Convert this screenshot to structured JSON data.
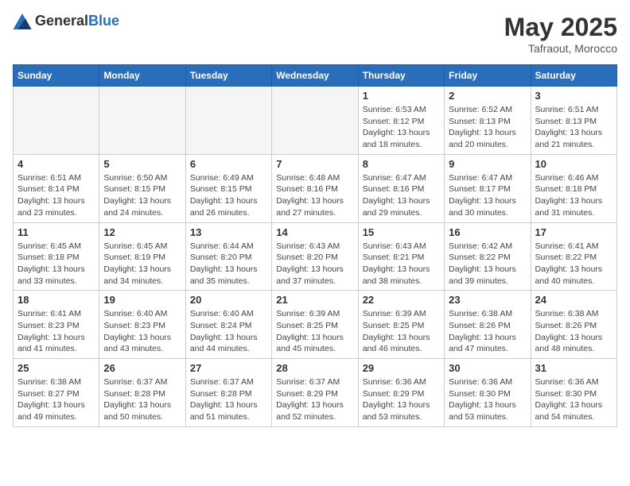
{
  "header": {
    "logo_general": "General",
    "logo_blue": "Blue",
    "month": "May 2025",
    "location": "Tafraout, Morocco"
  },
  "days_of_week": [
    "Sunday",
    "Monday",
    "Tuesday",
    "Wednesday",
    "Thursday",
    "Friday",
    "Saturday"
  ],
  "weeks": [
    [
      {
        "day": "",
        "empty": true
      },
      {
        "day": "",
        "empty": true
      },
      {
        "day": "",
        "empty": true
      },
      {
        "day": "",
        "empty": true
      },
      {
        "day": "1",
        "sunrise": "6:53 AM",
        "sunset": "8:12 PM",
        "daylight": "13 hours and 18 minutes."
      },
      {
        "day": "2",
        "sunrise": "6:52 AM",
        "sunset": "8:13 PM",
        "daylight": "13 hours and 20 minutes."
      },
      {
        "day": "3",
        "sunrise": "6:51 AM",
        "sunset": "8:13 PM",
        "daylight": "13 hours and 21 minutes."
      }
    ],
    [
      {
        "day": "4",
        "sunrise": "6:51 AM",
        "sunset": "8:14 PM",
        "daylight": "13 hours and 23 minutes."
      },
      {
        "day": "5",
        "sunrise": "6:50 AM",
        "sunset": "8:15 PM",
        "daylight": "13 hours and 24 minutes."
      },
      {
        "day": "6",
        "sunrise": "6:49 AM",
        "sunset": "8:15 PM",
        "daylight": "13 hours and 26 minutes."
      },
      {
        "day": "7",
        "sunrise": "6:48 AM",
        "sunset": "8:16 PM",
        "daylight": "13 hours and 27 minutes."
      },
      {
        "day": "8",
        "sunrise": "6:47 AM",
        "sunset": "8:16 PM",
        "daylight": "13 hours and 29 minutes."
      },
      {
        "day": "9",
        "sunrise": "6:47 AM",
        "sunset": "8:17 PM",
        "daylight": "13 hours and 30 minutes."
      },
      {
        "day": "10",
        "sunrise": "6:46 AM",
        "sunset": "8:18 PM",
        "daylight": "13 hours and 31 minutes."
      }
    ],
    [
      {
        "day": "11",
        "sunrise": "6:45 AM",
        "sunset": "8:18 PM",
        "daylight": "13 hours and 33 minutes."
      },
      {
        "day": "12",
        "sunrise": "6:45 AM",
        "sunset": "8:19 PM",
        "daylight": "13 hours and 34 minutes."
      },
      {
        "day": "13",
        "sunrise": "6:44 AM",
        "sunset": "8:20 PM",
        "daylight": "13 hours and 35 minutes."
      },
      {
        "day": "14",
        "sunrise": "6:43 AM",
        "sunset": "8:20 PM",
        "daylight": "13 hours and 37 minutes."
      },
      {
        "day": "15",
        "sunrise": "6:43 AM",
        "sunset": "8:21 PM",
        "daylight": "13 hours and 38 minutes."
      },
      {
        "day": "16",
        "sunrise": "6:42 AM",
        "sunset": "8:22 PM",
        "daylight": "13 hours and 39 minutes."
      },
      {
        "day": "17",
        "sunrise": "6:41 AM",
        "sunset": "8:22 PM",
        "daylight": "13 hours and 40 minutes."
      }
    ],
    [
      {
        "day": "18",
        "sunrise": "6:41 AM",
        "sunset": "8:23 PM",
        "daylight": "13 hours and 41 minutes."
      },
      {
        "day": "19",
        "sunrise": "6:40 AM",
        "sunset": "8:23 PM",
        "daylight": "13 hours and 43 minutes."
      },
      {
        "day": "20",
        "sunrise": "6:40 AM",
        "sunset": "8:24 PM",
        "daylight": "13 hours and 44 minutes."
      },
      {
        "day": "21",
        "sunrise": "6:39 AM",
        "sunset": "8:25 PM",
        "daylight": "13 hours and 45 minutes."
      },
      {
        "day": "22",
        "sunrise": "6:39 AM",
        "sunset": "8:25 PM",
        "daylight": "13 hours and 46 minutes."
      },
      {
        "day": "23",
        "sunrise": "6:38 AM",
        "sunset": "8:26 PM",
        "daylight": "13 hours and 47 minutes."
      },
      {
        "day": "24",
        "sunrise": "6:38 AM",
        "sunset": "8:26 PM",
        "daylight": "13 hours and 48 minutes."
      }
    ],
    [
      {
        "day": "25",
        "sunrise": "6:38 AM",
        "sunset": "8:27 PM",
        "daylight": "13 hours and 49 minutes."
      },
      {
        "day": "26",
        "sunrise": "6:37 AM",
        "sunset": "8:28 PM",
        "daylight": "13 hours and 50 minutes."
      },
      {
        "day": "27",
        "sunrise": "6:37 AM",
        "sunset": "8:28 PM",
        "daylight": "13 hours and 51 minutes."
      },
      {
        "day": "28",
        "sunrise": "6:37 AM",
        "sunset": "8:29 PM",
        "daylight": "13 hours and 52 minutes."
      },
      {
        "day": "29",
        "sunrise": "6:36 AM",
        "sunset": "8:29 PM",
        "daylight": "13 hours and 53 minutes."
      },
      {
        "day": "30",
        "sunrise": "6:36 AM",
        "sunset": "8:30 PM",
        "daylight": "13 hours and 53 minutes."
      },
      {
        "day": "31",
        "sunrise": "6:36 AM",
        "sunset": "8:30 PM",
        "daylight": "13 hours and 54 minutes."
      }
    ]
  ]
}
